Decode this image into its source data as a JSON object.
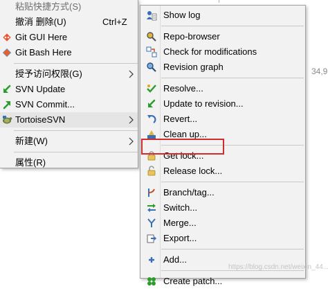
{
  "background": {
    "partial_text": "34,9"
  },
  "left_menu": {
    "items": [
      {
        "label": "粘贴快捷方式(S)",
        "dim": true
      },
      {
        "label": "撤消 删除(U)",
        "shortcut": "Ctrl+Z"
      },
      {
        "label": "Git GUI Here",
        "icon": "git-gui-icon"
      },
      {
        "label": "Git Bash Here",
        "icon": "git-bash-icon"
      },
      {
        "label": "授予访问权限(G)",
        "submenu": true
      },
      {
        "label": "SVN Update",
        "icon": "svn-update-icon"
      },
      {
        "label": "SVN Commit...",
        "icon": "svn-commit-icon"
      },
      {
        "label": "TortoiseSVN",
        "icon": "tortoisesvn-icon",
        "submenu": true,
        "active": true
      },
      {
        "label": "新建(W)",
        "submenu": true
      },
      {
        "label": "属性(R)"
      }
    ]
  },
  "right_menu": {
    "items": [
      {
        "label": "Show log",
        "icon": "show-log-icon"
      },
      {
        "label": "Repo-browser",
        "icon": "repo-browser-icon"
      },
      {
        "label": "Check for modifications",
        "icon": "check-modifications-icon"
      },
      {
        "label": "Revision graph",
        "icon": "revision-graph-icon"
      },
      {
        "label": "Resolve...",
        "icon": "resolve-icon"
      },
      {
        "label": "Update to revision...",
        "icon": "update-to-revision-icon"
      },
      {
        "label": "Revert...",
        "icon": "revert-icon"
      },
      {
        "label": "Clean up...",
        "icon": "clean-up-icon"
      },
      {
        "label": "Get lock...",
        "icon": "lock-icon"
      },
      {
        "label": "Release lock...",
        "icon": "unlock-icon"
      },
      {
        "label": "Branch/tag...",
        "icon": "branch-tag-icon"
      },
      {
        "label": "Switch...",
        "icon": "switch-icon"
      },
      {
        "label": "Merge...",
        "icon": "merge-icon"
      },
      {
        "label": "Export...",
        "icon": "export-icon"
      },
      {
        "label": "Add...",
        "icon": "add-icon"
      },
      {
        "label": "Create patch...",
        "icon": "create-patch-icon"
      }
    ]
  },
  "annotation": {
    "highlight_color": "#d32a2a"
  },
  "watermark": {
    "text": "https://blog.csdn.net/weixin_44..."
  }
}
